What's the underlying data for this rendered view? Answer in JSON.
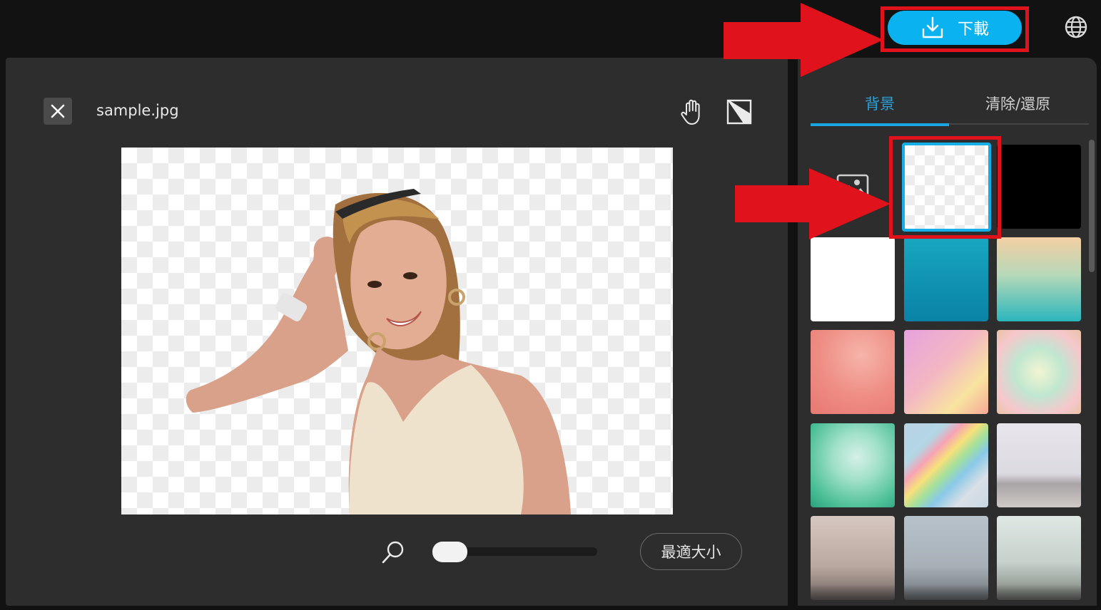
{
  "topbar": {
    "download_label": "下載",
    "download_icon": "download-icon",
    "language_icon": "globe-icon"
  },
  "editor": {
    "close_icon": "close-icon",
    "filename": "sample.jpg",
    "tools": [
      "hand-icon",
      "eraser-icon"
    ],
    "zoom_icon": "search-icon",
    "zoom_level": 0,
    "fit_button_label": "最適大小"
  },
  "sidebar": {
    "tabs": [
      {
        "label": "背景",
        "active": true
      },
      {
        "label": "清除/還原",
        "active": false
      }
    ],
    "backgrounds": [
      {
        "name": "upload-image"
      },
      {
        "name": "transparent",
        "selected": true
      },
      {
        "name": "black"
      },
      {
        "name": "white"
      },
      {
        "name": "teal-gradient"
      },
      {
        "name": "sunset-gradient"
      },
      {
        "name": "pink-glitter"
      },
      {
        "name": "pastel-gradient"
      },
      {
        "name": "holographic"
      },
      {
        "name": "aurora"
      },
      {
        "name": "rainbow"
      },
      {
        "name": "beach"
      },
      {
        "name": "fog-pink"
      },
      {
        "name": "fog-blue"
      },
      {
        "name": "fog-green"
      }
    ]
  },
  "colors": {
    "accent": "#1ca7e2",
    "download_button": "#0ab3f0",
    "annotation": "#e0121b",
    "panel": "#2d2d2d",
    "background": "#121212"
  }
}
